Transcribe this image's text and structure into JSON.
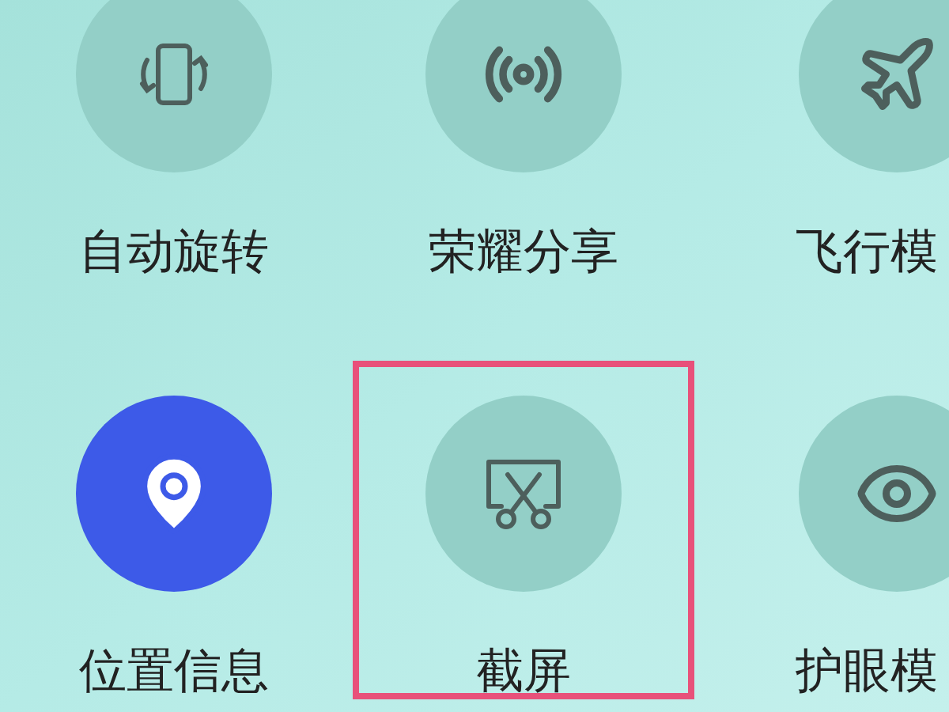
{
  "tiles": [
    {
      "label": "自动旋转",
      "on": false,
      "highlighted": false
    },
    {
      "label": "荣耀分享",
      "on": false,
      "highlighted": false
    },
    {
      "label": "飞行模",
      "on": false,
      "highlighted": false
    },
    {
      "label": "位置信息",
      "on": true,
      "highlighted": false
    },
    {
      "label": "截屏",
      "on": false,
      "highlighted": true
    },
    {
      "label": "护眼模",
      "on": false,
      "highlighted": false
    }
  ]
}
